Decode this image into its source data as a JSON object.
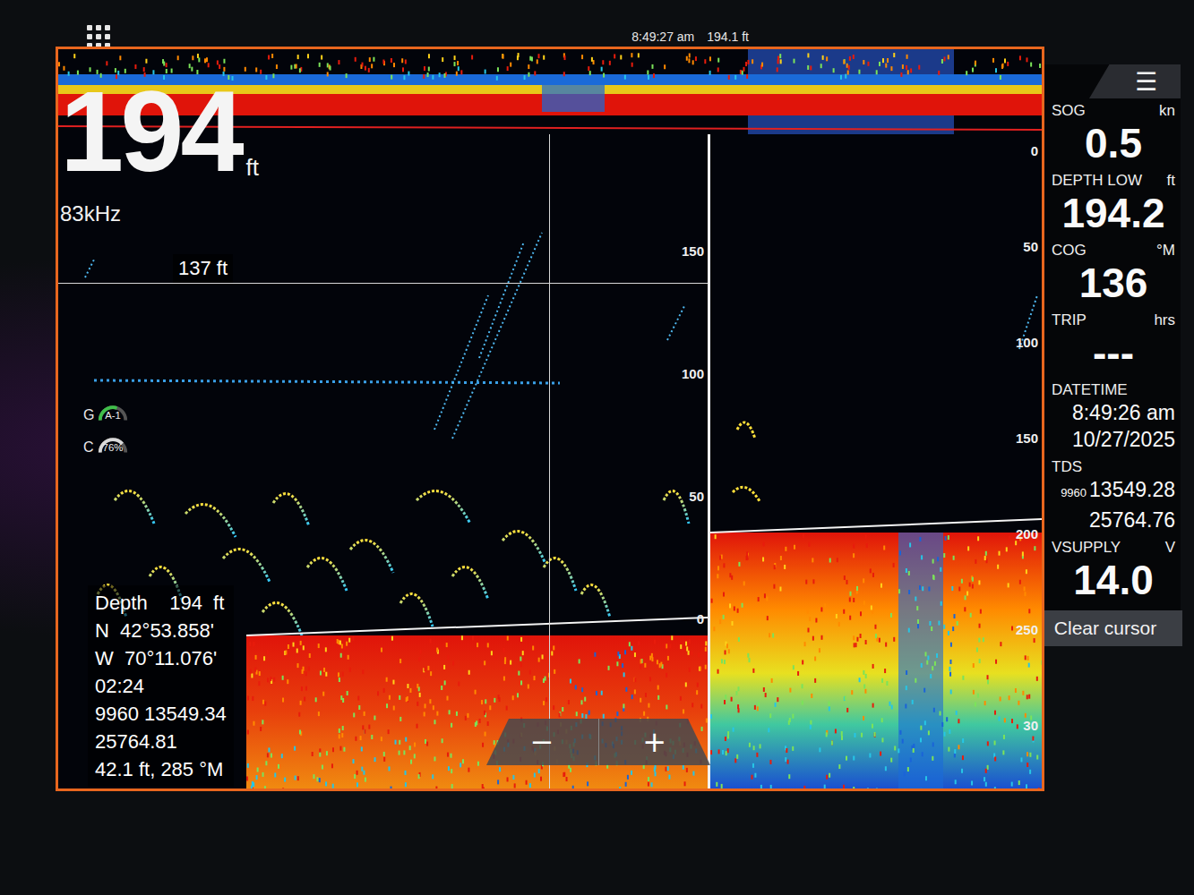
{
  "status_bar": {
    "time": "8:49:27 am",
    "depth": "194.1 ft"
  },
  "depth_readout": {
    "value": "194",
    "unit": "ft",
    "frequency": "83kHz"
  },
  "gauges": [
    {
      "letter": "G",
      "label": "A-1",
      "level": 0.6,
      "color": "#3fbf4a"
    },
    {
      "letter": "C",
      "label": "76%",
      "level": 0.76,
      "color": "#d9d9d9"
    }
  ],
  "cursor": {
    "label": "137 ft"
  },
  "left_scale": [
    "150",
    "100",
    "50",
    "0"
  ],
  "right_scale": [
    "0",
    "50",
    "100",
    "150",
    "200",
    "250",
    "30"
  ],
  "info_box": [
    "Depth    194  ft",
    "N  42°53.858'",
    "W  70°11.076'",
    "02:24",
    "9960 13549.34",
    "25764.81",
    "42.1 ft, 285 °M"
  ],
  "zoom_buttons": [
    "−",
    "+"
  ],
  "menu_icon": "☰",
  "sidebar": [
    {
      "label": "SOG",
      "unit": "kn",
      "kind": "big",
      "values": [
        {
          "prefix": "",
          "text": "0.5"
        }
      ]
    },
    {
      "label": "DEPTH LOW",
      "unit": "ft",
      "kind": "big",
      "values": [
        {
          "prefix": "",
          "text": "194.2"
        }
      ]
    },
    {
      "label": "COG",
      "unit": "°M",
      "kind": "big",
      "values": [
        {
          "prefix": "",
          "text": "136"
        }
      ]
    },
    {
      "label": "TRIP",
      "unit": "hrs",
      "kind": "big",
      "values": [
        {
          "prefix": "",
          "text": "---"
        }
      ]
    },
    {
      "label": "DATETIME",
      "unit": "",
      "kind": "medium",
      "values": [
        {
          "prefix": "",
          "text": "8:49:26 am"
        },
        {
          "prefix": "",
          "text": "10/27/2025"
        }
      ]
    },
    {
      "label": "TDS",
      "unit": "",
      "kind": "medium",
      "values": [
        {
          "prefix": "9960",
          "text": "13549.28"
        },
        {
          "prefix": "",
          "text": "25764.76"
        }
      ]
    },
    {
      "label": "VSUPPLY",
      "unit": "V",
      "kind": "big",
      "values": [
        {
          "prefix": "",
          "text": "14.0"
        }
      ]
    }
  ],
  "clear_button": "Clear cursor"
}
